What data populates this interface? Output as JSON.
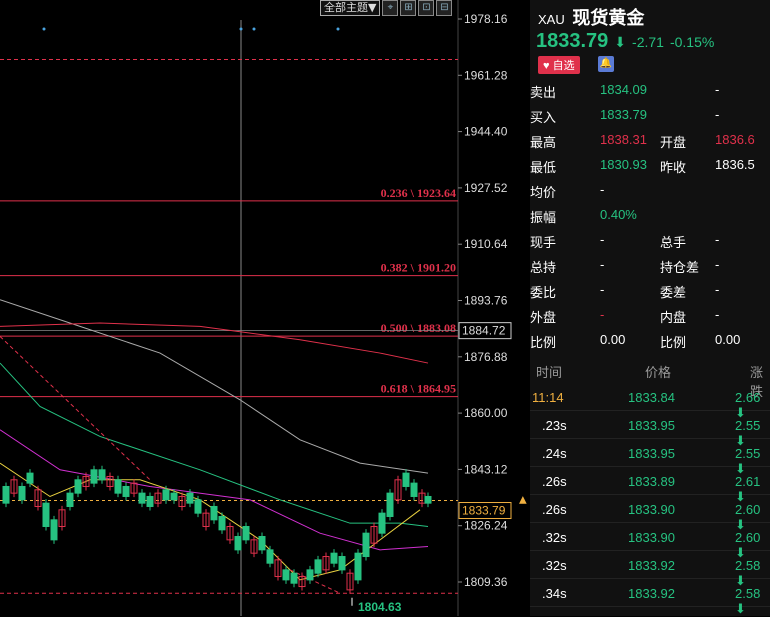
{
  "toolbar": {
    "theme_label": "全部主题▼",
    "icons": [
      "cursor-icon",
      "zoom-icon",
      "crosshair-icon",
      "layout-icon"
    ]
  },
  "chart_data": {
    "type": "candlestick",
    "y_ticks": [
      "1978.16",
      "1961.28",
      "1944.40",
      "1927.52",
      "1910.64",
      "1893.76",
      "1876.88",
      "1860.00",
      "1843.12",
      "1826.24",
      "1809.36"
    ],
    "ylim": [
      1804.0,
      1982.0
    ],
    "fib_levels": [
      {
        "label": "0.236 \\ 1923.64",
        "value": 1923.64
      },
      {
        "label": "0.382 \\ 1901.20",
        "value": 1901.2
      },
      {
        "label": "0.500 \\ 1883.08",
        "value": 1883.08
      },
      {
        "label": "0.618 \\ 1864.95",
        "value": 1864.95
      }
    ],
    "dashed_levels": [
      1966.0,
      1806.0
    ],
    "hover_price": "1884.72",
    "hover_value": 1884.72,
    "last_price": "1833.79",
    "last_value": 1833.79,
    "low_label": "1804.63",
    "low_value": 1804.63
  },
  "quote": {
    "code": "XAU",
    "name": "现货黄金",
    "price": "1833.79",
    "change": "-2.71",
    "change_pct": "-0.15%",
    "fav_label": "自选",
    "rows": [
      {
        "l1": "卖出",
        "v1": "1834.09",
        "c1": "green",
        "l2": "",
        "v2": "-",
        "c2": "white"
      },
      {
        "l1": "买入",
        "v1": "1833.79",
        "c1": "green",
        "l2": "",
        "v2": "-",
        "c2": "white"
      },
      {
        "l1": "最高",
        "v1": "1838.31",
        "c1": "red",
        "l2": "开盘",
        "v2": "1836.6",
        "c2": "red"
      },
      {
        "l1": "最低",
        "v1": "1830.93",
        "c1": "green",
        "l2": "昨收",
        "v2": "1836.5",
        "c2": "white"
      },
      {
        "l1": "均价",
        "v1": "-",
        "c1": "white",
        "l2": "",
        "v2": "",
        "c2": "white"
      },
      {
        "l1": "振幅",
        "v1": "0.40%",
        "c1": "green",
        "l2": "",
        "v2": "",
        "c2": "white"
      },
      {
        "l1": "现手",
        "v1": "-",
        "c1": "white",
        "l2": "总手",
        "v2": "-",
        "c2": "white"
      },
      {
        "l1": "总持",
        "v1": "-",
        "c1": "white",
        "l2": "持仓差",
        "v2": "-",
        "c2": "white"
      },
      {
        "l1": "委比",
        "v1": "-",
        "c1": "white",
        "l2": "委差",
        "v2": "-",
        "c2": "white"
      },
      {
        "l1": "外盘",
        "v1": "-",
        "c1": "red",
        "l2": "内盘",
        "v2": "-",
        "c2": "white"
      },
      {
        "l1": "比例",
        "v1": "0.00",
        "c1": "white",
        "l2": "比例",
        "v2": "0.00",
        "c2": "white"
      }
    ]
  },
  "ticks": {
    "headers": [
      "时间",
      "价格",
      "涨跌"
    ],
    "rows": [
      {
        "time": "11:14",
        "price": "1833.84",
        "chg": "2.66"
      },
      {
        "time": ".23s",
        "price": "1833.95",
        "chg": "2.55"
      },
      {
        "time": ".24s",
        "price": "1833.95",
        "chg": "2.55"
      },
      {
        "time": ".26s",
        "price": "1833.89",
        "chg": "2.61"
      },
      {
        "time": ".26s",
        "price": "1833.90",
        "chg": "2.60"
      },
      {
        "time": ".32s",
        "price": "1833.90",
        "chg": "2.60"
      },
      {
        "time": ".32s",
        "price": "1833.92",
        "chg": "2.58"
      },
      {
        "time": ".34s",
        "price": "1833.92",
        "chg": "2.58"
      }
    ]
  }
}
